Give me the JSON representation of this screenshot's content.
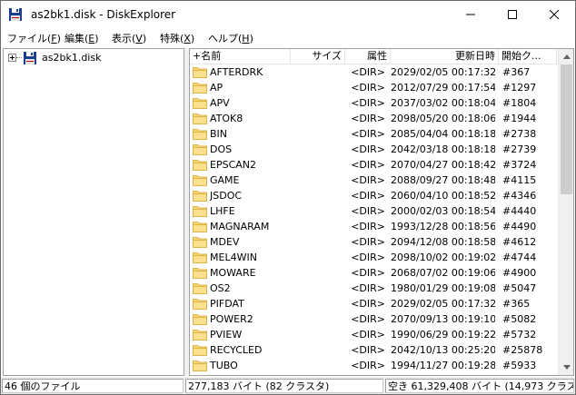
{
  "window": {
    "title": "as2bk1.disk - DiskExplorer",
    "minimize_icon": "minimize-icon",
    "maximize_icon": "maximize-icon",
    "close_icon": "close-icon"
  },
  "menu": [
    {
      "label": "ファイル(",
      "accel": "F",
      "tail": ")"
    },
    {
      "label": "編集(",
      "accel": "E",
      "tail": ")"
    },
    {
      "label": "表示(",
      "accel": "V",
      "tail": ")"
    },
    {
      "label": "特殊(",
      "accel": "X",
      "tail": ")"
    },
    {
      "label": "ヘルプ(",
      "accel": "H",
      "tail": ")"
    }
  ],
  "tree": {
    "root_label": "as2bk1.disk",
    "root_icon": "floppy-disk-icon"
  },
  "columns": [
    "+名前",
    "サイズ",
    "属性",
    "更新日時",
    "開始ク..."
  ],
  "files": [
    {
      "name": "AFTERDRK",
      "size": "",
      "attr": "<DIR>",
      "date": "2029/02/05 00:17:32",
      "cluster": "#367"
    },
    {
      "name": "AP",
      "size": "",
      "attr": "<DIR>",
      "date": "2012/07/29 00:17:54",
      "cluster": "#1297"
    },
    {
      "name": "APV",
      "size": "",
      "attr": "<DIR>",
      "date": "2037/03/02 00:18:04",
      "cluster": "#1804"
    },
    {
      "name": "ATOK8",
      "size": "",
      "attr": "<DIR>",
      "date": "2098/05/20 00:18:06",
      "cluster": "#1944"
    },
    {
      "name": "BIN",
      "size": "",
      "attr": "<DIR>",
      "date": "2085/04/04 00:18:18",
      "cluster": "#2738"
    },
    {
      "name": "DOS",
      "size": "",
      "attr": "<DIR>",
      "date": "2042/03/18 00:18:18",
      "cluster": "#2739"
    },
    {
      "name": "EPSCAN2",
      "size": "",
      "attr": "<DIR>",
      "date": "2070/04/27 00:18:42",
      "cluster": "#3724"
    },
    {
      "name": "GAME",
      "size": "",
      "attr": "<DIR>",
      "date": "2088/09/27 00:18:48",
      "cluster": "#4115"
    },
    {
      "name": "JSDOC",
      "size": "",
      "attr": "<DIR>",
      "date": "2060/04/10 00:18:52",
      "cluster": "#4346"
    },
    {
      "name": "LHFE",
      "size": "",
      "attr": "<DIR>",
      "date": "2000/02/03 00:18:54",
      "cluster": "#4440"
    },
    {
      "name": "MAGNARAM",
      "size": "",
      "attr": "<DIR>",
      "date": "1993/12/28 00:18:56",
      "cluster": "#4490"
    },
    {
      "name": "MDEV",
      "size": "",
      "attr": "<DIR>",
      "date": "2094/12/08 00:18:58",
      "cluster": "#4612"
    },
    {
      "name": "MEL4WIN",
      "size": "",
      "attr": "<DIR>",
      "date": "2098/10/02 00:19:02",
      "cluster": "#4744"
    },
    {
      "name": "MOWARE",
      "size": "",
      "attr": "<DIR>",
      "date": "2068/07/02 00:19:06",
      "cluster": "#4900"
    },
    {
      "name": "OS2",
      "size": "",
      "attr": "<DIR>",
      "date": "1980/01/29 00:19:08",
      "cluster": "#5047"
    },
    {
      "name": "PIFDAT",
      "size": "",
      "attr": "<DIR>",
      "date": "2029/02/05 00:17:32",
      "cluster": "#365"
    },
    {
      "name": "POWER2",
      "size": "",
      "attr": "<DIR>",
      "date": "2070/09/13 00:19:10",
      "cluster": "#5082"
    },
    {
      "name": "PVIEW",
      "size": "",
      "attr": "<DIR>",
      "date": "1990/06/29 00:19:22",
      "cluster": "#5732"
    },
    {
      "name": "RECYCLED",
      "size": "",
      "attr": "<DIR>",
      "date": "2042/10/13 00:25:20",
      "cluster": "#25878"
    },
    {
      "name": "TUBO",
      "size": "",
      "attr": "<DIR>",
      "date": "1994/11/27 00:19:28",
      "cluster": "#5933"
    }
  ],
  "status": {
    "file_count": "46 個のファイル",
    "used": "277,183 バイト (82 クラスタ)",
    "free": "空き 61,329,408 バイト (14,973 クラスタ)"
  },
  "colors": {
    "folder_fill": "#f8d775",
    "folder_edge": "#dcb449",
    "disk_blue": "#1a3d8f"
  }
}
